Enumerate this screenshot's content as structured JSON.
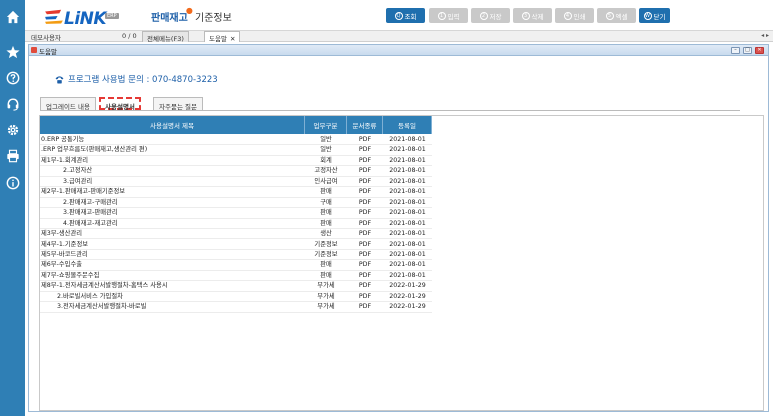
{
  "header": {
    "logo_text": "LiNK",
    "logo_badge": "ERP",
    "menu": [
      "판매재고",
      "기준정보"
    ],
    "buttons": [
      {
        "num": "Q",
        "label": "조회",
        "active": true
      },
      {
        "num": "1",
        "label": "입력",
        "active": false
      },
      {
        "num": "2",
        "label": "저장",
        "active": false
      },
      {
        "num": "3",
        "label": "삭제",
        "active": false
      },
      {
        "num": "4",
        "label": "인쇄",
        "active": false
      },
      {
        "num": "5",
        "label": "엑셀",
        "active": false
      },
      {
        "num": "W",
        "label": "닫기",
        "active": true
      }
    ]
  },
  "tabbar": {
    "user": "데모사용자",
    "count": "0 / 0",
    "tabs": [
      "전체메뉴(F3)",
      "도움말"
    ],
    "arrows": "◂ ▸"
  },
  "window": {
    "title": "도움말",
    "phone": "프로그램 사용법 문의 : 070-4870-3223",
    "tabs": [
      "업그레이드 내용",
      "사용설명서",
      "자주묻는 질문"
    ],
    "active_tab": 1,
    "columns": [
      "사용설명서 제목",
      "업무구분",
      "문서종류",
      "등록일"
    ],
    "rows": [
      {
        "title": "0.ERP 공통기능",
        "level": 0,
        "cat": "일반",
        "doc": "PDF",
        "date": "2021-08-01"
      },
      {
        "title": ".ERP 업무흐름도(판매재고,생산관리 편)",
        "level": 0,
        "cat": "일반",
        "doc": "PDF",
        "date": "2021-08-01"
      },
      {
        "title": "제1부-1.회계관리",
        "level": 0,
        "cat": "회계",
        "doc": "PDF",
        "date": "2021-08-01"
      },
      {
        "title": "2.고정자산",
        "level": 1,
        "cat": "고정자산",
        "doc": "PDF",
        "date": "2021-08-01"
      },
      {
        "title": "3.급여관리",
        "level": 1,
        "cat": "인사급여",
        "doc": "PDF",
        "date": "2021-08-01"
      },
      {
        "title": "제2부-1.판매재고-판매기준정보",
        "level": 0,
        "cat": "판매",
        "doc": "PDF",
        "date": "2021-08-01"
      },
      {
        "title": "2.판매재고-구매관리",
        "level": 1,
        "cat": "구매",
        "doc": "PDF",
        "date": "2021-08-01"
      },
      {
        "title": "3.판매재고-판매관리",
        "level": 1,
        "cat": "판매",
        "doc": "PDF",
        "date": "2021-08-01"
      },
      {
        "title": "4.판매재고-재고관리",
        "level": 1,
        "cat": "판매",
        "doc": "PDF",
        "date": "2021-08-01"
      },
      {
        "title": "제3부-생산관리",
        "level": 0,
        "cat": "생산",
        "doc": "PDF",
        "date": "2021-08-01"
      },
      {
        "title": "제4부-1.기준정보",
        "level": 0,
        "cat": "기준정보",
        "doc": "PDF",
        "date": "2021-08-01"
      },
      {
        "title": "제5부-바코드관리",
        "level": 0,
        "cat": "기준정보",
        "doc": "PDF",
        "date": "2021-08-01"
      },
      {
        "title": "제6부-수입수출",
        "level": 0,
        "cat": "판매",
        "doc": "PDF",
        "date": "2021-08-01"
      },
      {
        "title": "제7부-쇼핑몰주문수집",
        "level": 0,
        "cat": "판매",
        "doc": "PDF",
        "date": "2021-08-01"
      },
      {
        "title": "제8부-1.전자세금계산서발행절차-홈택스 사용시",
        "level": 0,
        "cat": "부가세",
        "doc": "PDF",
        "date": "2022-01-29"
      },
      {
        "title": "2.바로빌서비스 가입절차",
        "level": 2,
        "cat": "부가세",
        "doc": "PDF",
        "date": "2022-01-29"
      },
      {
        "title": "3.전자세금계산서발행절차-바로빌",
        "level": 2,
        "cat": "부가세",
        "doc": "PDF",
        "date": "2022-01-29"
      }
    ]
  },
  "colors": {
    "sidebar": "#2f7fb5",
    "header_table": "#2f7fb5",
    "button_active": "#1f6fae",
    "button_disabled": "#c9c9c9",
    "link_text": "#1d5fa8",
    "highlight_box": "#e53935"
  },
  "icons": [
    "home-icon",
    "star-icon",
    "question-icon",
    "headset-icon",
    "gear-icon",
    "printer-icon",
    "info-icon",
    "phone-icon"
  ]
}
